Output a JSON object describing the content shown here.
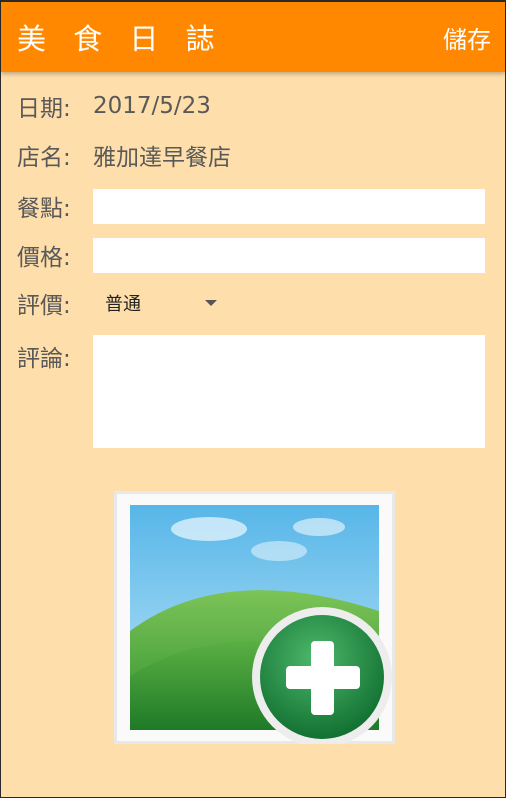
{
  "toolbar": {
    "title": "美 食 日 誌",
    "save_label": "儲存"
  },
  "form": {
    "date_label": "日期:",
    "date_value": "2017/5/23",
    "store_label": "店名:",
    "store_value": "雅加達早餐店",
    "meal_label": "餐點:",
    "meal_value": "",
    "price_label": "價格:",
    "price_value": "",
    "rating_label": "評價:",
    "rating_selected": "普通",
    "comment_label": "評論:",
    "comment_value": ""
  },
  "image_picker": {
    "icon": "add-photo-icon"
  },
  "colors": {
    "toolbar": "#FF8800",
    "background": "#FEDEAA",
    "text": "#595959"
  }
}
